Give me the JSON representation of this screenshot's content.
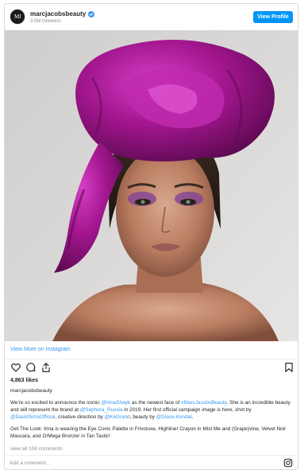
{
  "header": {
    "username": "marcjacobsbeauty",
    "followers": "3.5M followers",
    "view_profile_label": "View Profile",
    "avatar_text": "MJ"
  },
  "photo": {
    "alt": "Model wearing a large magenta silk headwrap with purple eye makeup"
  },
  "view_more": {
    "label": "View More on Instagram"
  },
  "actions": {
    "icons": [
      "heart-icon",
      "comment-icon",
      "share-icon",
      "bookmark-icon"
    ]
  },
  "likes": "4,863 likes",
  "caption": {
    "username": "marcjacobsbeauty",
    "p1": {
      "t1": "We're so excited to announce the iconic ",
      "m1": "@IrinaShayk",
      "t2": " as the newest face of ",
      "m2": "#MarcJacobsBeauty",
      "t3": ". She is an incredible beauty and will represent the brand at ",
      "m3": "@Sephora_Russia",
      "t4": " in 2019. Her first official campaign image is here, shot by ",
      "m4": "@DavidSimsOfficial",
      "t5": ", creative direction by ",
      "m5": "@KeGrand",
      "t6": ", beauty by ",
      "m6": "@Diane.Kendal",
      "t7": "."
    },
    "p2": "Get The Look: Irina is wearing the Eye Conic Palette in Frivoluxe, Highliner Crayon in Mist Me and (Grape)vine, Velvet Noir Mascara, and O!Mega Bronzer in Tan Tastic!"
  },
  "comments_link": "view all 108 comments",
  "comment_input": {
    "placeholder": "Add a comment..."
  },
  "colors": {
    "accent": "#0095f6",
    "link": "#3897f0",
    "headwrap": "#a3168f"
  }
}
